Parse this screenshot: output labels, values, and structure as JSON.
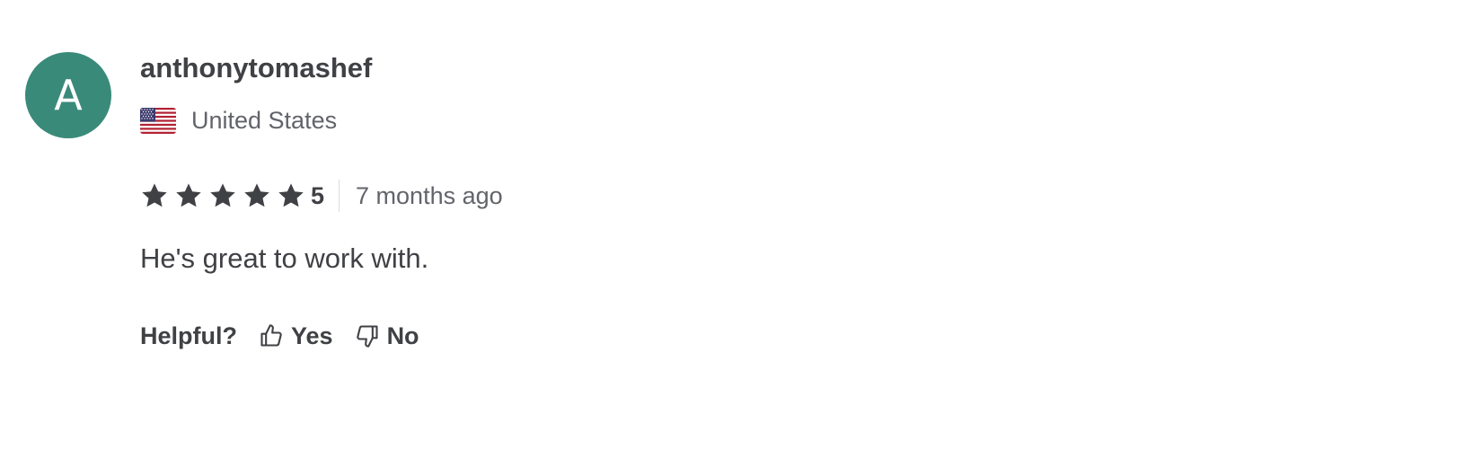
{
  "reviewer": {
    "avatar_letter": "A",
    "avatar_color": "#3a8a7a",
    "username": "anthonytomashef",
    "country": "United States",
    "flag_icon": "us-flag-icon"
  },
  "rating": {
    "stars_filled": 5,
    "stars_total": 5,
    "value": "5",
    "star_color": "#404145",
    "time_ago": "7 months ago"
  },
  "review": {
    "text": "He's great to work with."
  },
  "helpful": {
    "label": "Helpful?",
    "yes_label": "Yes",
    "no_label": "No",
    "yes_icon": "thumbs-up-icon",
    "no_icon": "thumbs-down-icon"
  }
}
